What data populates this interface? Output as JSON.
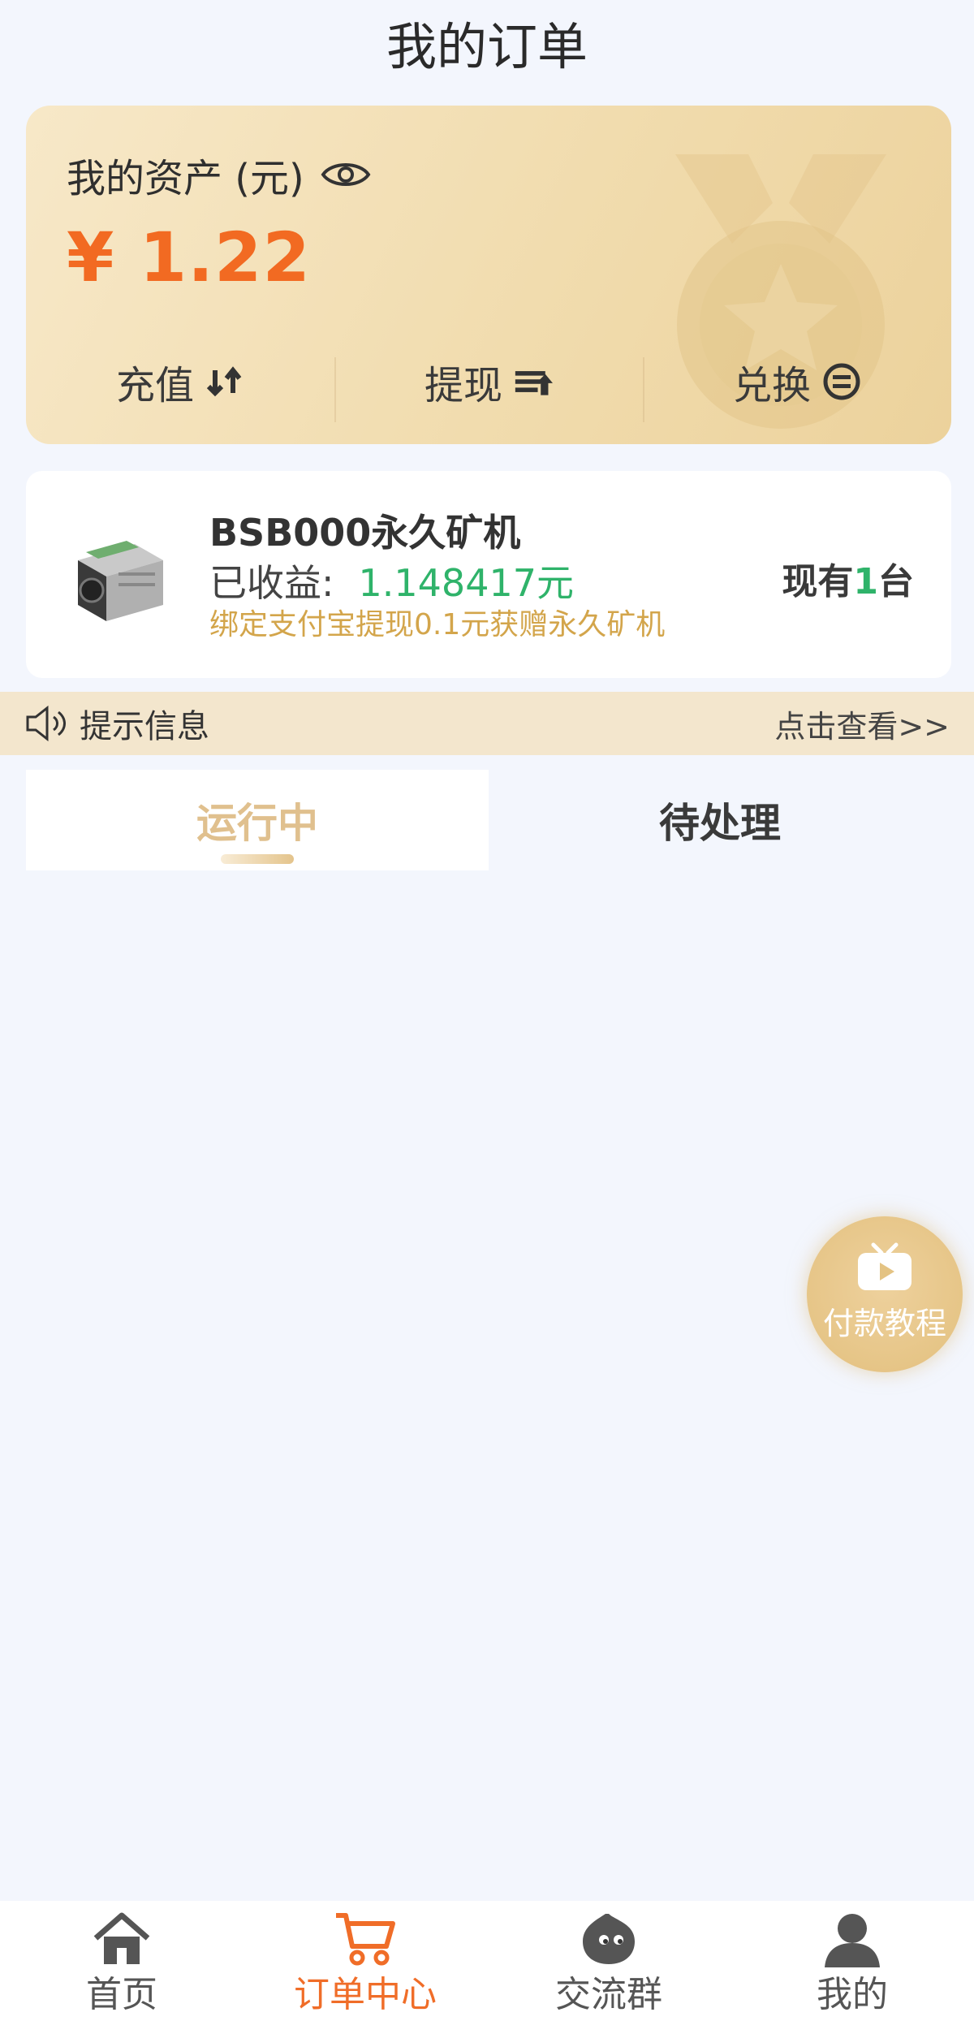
{
  "header": {
    "title": "我的订单"
  },
  "assets": {
    "label": "我的资产 (元)",
    "amount": "¥ 1.22",
    "actions": [
      {
        "label": "充值",
        "icon": "recharge-arrows-icon"
      },
      {
        "label": "提现",
        "icon": "withdraw-icon"
      },
      {
        "label": "兑换",
        "icon": "exchange-icon"
      }
    ]
  },
  "miner": {
    "name": "BSB000永久矿机",
    "earn_label": "已收益:",
    "earn_value": "1.148417元",
    "promo": "绑定支付宝提现0.1元获赠永久矿机",
    "count_prefix": "现有",
    "count_value": "1",
    "count_suffix": "台"
  },
  "notice": {
    "label": "提示信息",
    "link": "点击查看>>"
  },
  "tabs": [
    {
      "label": "运行中",
      "active": true
    },
    {
      "label": "待处理",
      "active": false
    }
  ],
  "float_button": {
    "label": "付款教程",
    "icon": "tv-play-icon"
  },
  "bottom_nav": [
    {
      "label": "首页",
      "icon": "home-icon",
      "active": false
    },
    {
      "label": "订单中心",
      "icon": "cart-icon",
      "active": true
    },
    {
      "label": "交流群",
      "icon": "chat-bubble-icon",
      "active": false
    },
    {
      "label": "我的",
      "icon": "user-icon",
      "active": false
    }
  ],
  "colors": {
    "accent_orange": "#f06d28",
    "amount_orange": "#f26a22",
    "earn_green": "#2fb36a",
    "gold": "#e0c08e",
    "background": "#f3f6fd"
  }
}
